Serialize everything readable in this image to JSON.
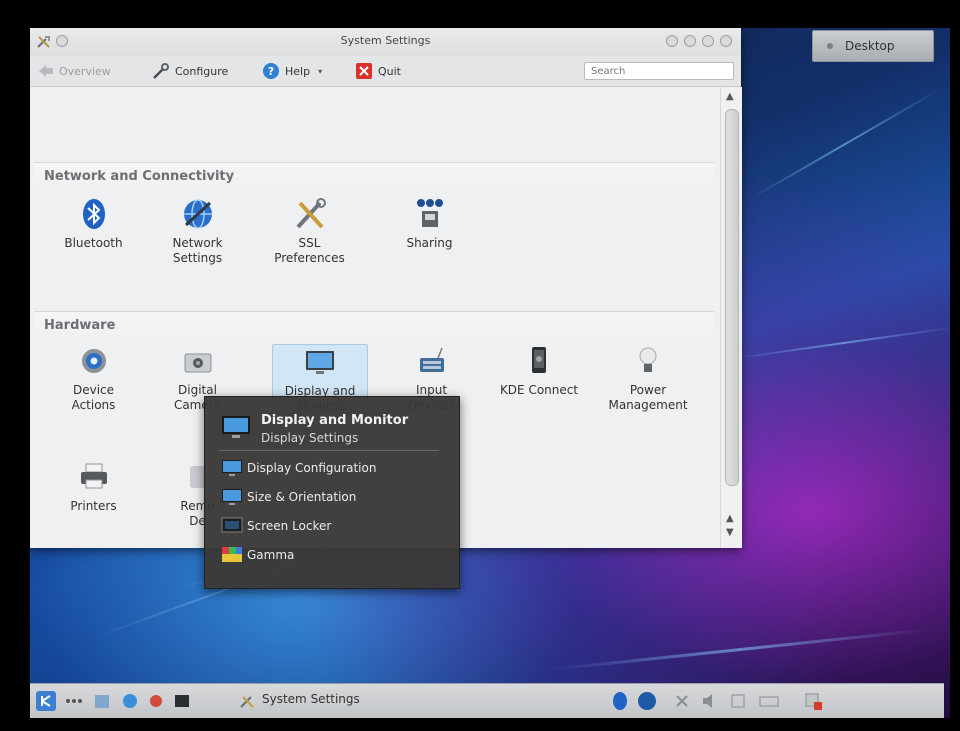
{
  "window": {
    "title": "System Settings",
    "toolbar": {
      "overview": "Overview",
      "configure": "Configure",
      "help": "Help",
      "quit": "Quit",
      "search_placeholder": "Search"
    }
  },
  "sections": {
    "network": {
      "title": "Network and Connectivity",
      "items": [
        {
          "label": "Bluetooth",
          "icon": "bluetooth-icon"
        },
        {
          "label": "Network\nSettings",
          "icon": "network-globe-icon"
        },
        {
          "label": "SSL\nPreferences",
          "icon": "tools-icon"
        },
        {
          "label": "Sharing",
          "icon": "sharing-icon"
        }
      ]
    },
    "hardware": {
      "title": "Hardware",
      "items": [
        {
          "label": "Device\nActions",
          "icon": "gear-icon"
        },
        {
          "label": "Digital\nCamera",
          "icon": "camera-icon"
        },
        {
          "label": "Display and\nMonitor",
          "icon": "monitor-icon",
          "selected": true
        },
        {
          "label": "Input\nDevices",
          "icon": "keyboard-icon"
        },
        {
          "label": "KDE Connect",
          "icon": "phone-icon"
        },
        {
          "label": "Power\nManagement",
          "icon": "lightbulb-icon"
        },
        {
          "label": "Printers",
          "icon": "printer-icon"
        },
        {
          "label": "Remo\nDe",
          "icon": "remote-icon"
        }
      ]
    }
  },
  "popup": {
    "title": "Display and Monitor",
    "subtitle": "Display Settings",
    "items": [
      {
        "label": "Display Configuration",
        "icon": "display-icon"
      },
      {
        "label": "Size & Orientation",
        "icon": "display-icon"
      },
      {
        "label": "Screen Locker",
        "icon": "screen-lock-icon"
      },
      {
        "label": "Gamma",
        "icon": "gamma-icon"
      }
    ]
  },
  "desktop_button": "Desktop",
  "taskbar": {
    "task": "System Settings"
  },
  "colors": {
    "selection": "#d3e6f5",
    "popup_bg": "#3a3836",
    "accent": "#3a8fd8"
  }
}
